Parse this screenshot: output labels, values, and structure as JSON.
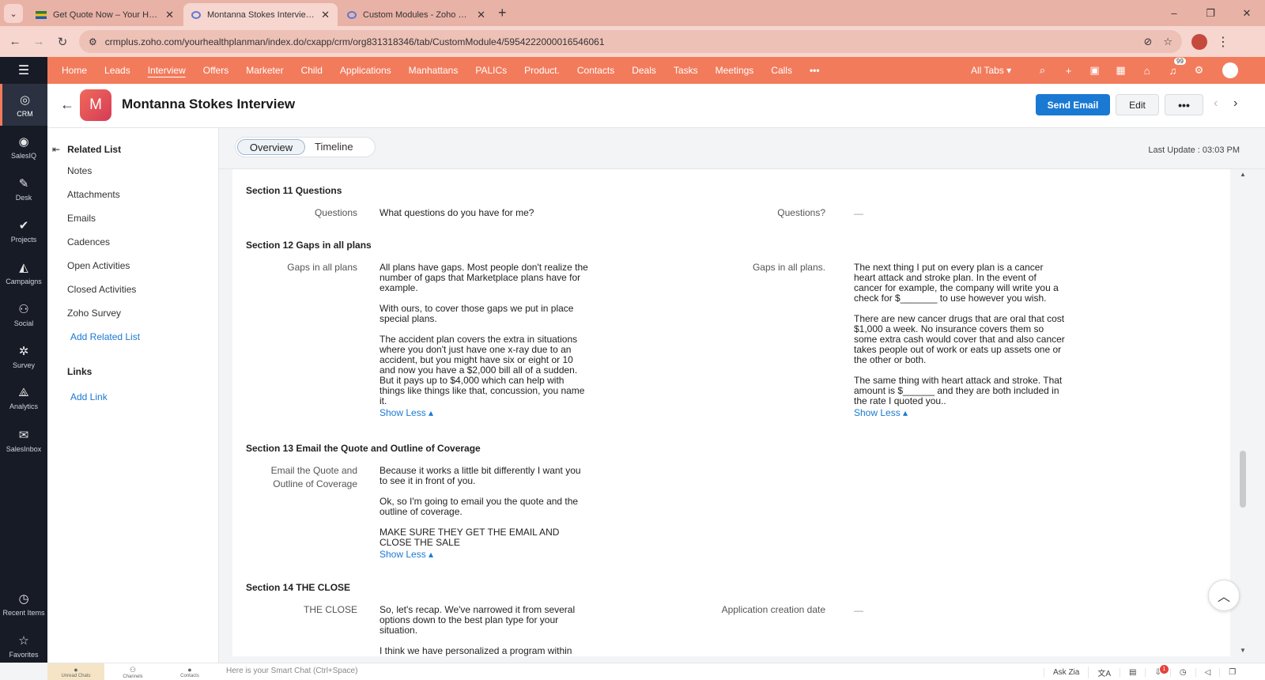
{
  "browser": {
    "tabs": [
      {
        "title": "Get Quote Now – Your Health P",
        "active": false
      },
      {
        "title": "Montanna Stokes Interview (Int",
        "active": true
      },
      {
        "title": "Custom Modules - Zoho CRM",
        "active": false
      }
    ],
    "url": "crmplus.zoho.com/yourhealthplanman/index.do/cxapp/crm/org831318346/tab/CustomModule4/5954222000016546061"
  },
  "topnav": {
    "items": [
      "Home",
      "Leads",
      "Interview",
      "Offers",
      "Marketer",
      "Child",
      "Applications",
      "Manhattans",
      "PALICs",
      "Product.",
      "Contacts",
      "Deals",
      "Tasks",
      "Meetings",
      "Calls"
    ],
    "active": "Interview",
    "more": "•••",
    "all_tabs": "All Tabs ▾",
    "notification_count": "99"
  },
  "leftbar": {
    "items": [
      {
        "label": "CRM",
        "icon": "crm-icon"
      },
      {
        "label": "SalesIQ",
        "icon": "salesiq-icon"
      },
      {
        "label": "Desk",
        "icon": "desk-icon"
      },
      {
        "label": "Projects",
        "icon": "projects-icon"
      },
      {
        "label": "Campaigns",
        "icon": "campaigns-icon"
      },
      {
        "label": "Social",
        "icon": "social-icon"
      },
      {
        "label": "Survey",
        "icon": "survey-icon"
      },
      {
        "label": "Analytics",
        "icon": "analytics-icon"
      },
      {
        "label": "SalesInbox",
        "icon": "salesinbox-icon"
      }
    ],
    "bottom": [
      {
        "label": "Recent Items",
        "icon": "clock-icon"
      },
      {
        "label": "Favorites",
        "icon": "star-icon"
      }
    ]
  },
  "record": {
    "avatar_letter": "M",
    "title": "Montanna Stokes Interview",
    "send_email": "Send Email",
    "edit": "Edit",
    "more": "•••"
  },
  "related": {
    "header": "Related List",
    "items": [
      "Notes",
      "Attachments",
      "Emails",
      "Cadences",
      "Open Activities",
      "Closed Activities",
      "Zoho Survey"
    ],
    "add_related": "Add Related List",
    "links_header": "Links",
    "add_link": "Add Link"
  },
  "view_tabs": {
    "overview": "Overview",
    "timeline": "Timeline"
  },
  "last_update": "Last Update : 03:03 PM",
  "sections": {
    "s11": {
      "title": "Section 11 Questions",
      "left_label": "Questions",
      "left_value": "What questions do you have for me?",
      "right_label": "Questions?",
      "right_value": "—"
    },
    "s12": {
      "title": "Section 12 Gaps in all plans",
      "left_label": "Gaps in all plans",
      "left_paragraphs": [
        "All plans have gaps. Most people don't realize the number of gaps that Marketplace plans have for example.",
        "With ours, to cover those gaps we put in place special plans.",
        "The accident plan covers the extra in situations where you don't just have one x-ray due to an accident, but you might have six or eight or 10 and now you have a $2,000 bill all of a sudden. But it pays up to $4,000 which can help with things like things like that, concussion, you name it."
      ],
      "right_label": "Gaps in all plans.",
      "right_paragraphs": [
        "The next thing I put on every plan is a cancer heart attack and stroke plan. In the event of cancer for example, the company will write you a check for $_______ to use however you wish.",
        "There are new cancer drugs that are oral that cost $1,000 a week. No insurance covers them so some extra cash would cover that and also cancer takes people out of work or eats up assets one or the other or both.",
        "The same thing with heart attack and stroke. That amount is $______ and they are both included in the rate I quoted you.."
      ]
    },
    "s13": {
      "title": "Section 13 Email the Quote and Outline of Coverage",
      "left_label": "Email the Quote and Outline of Coverage",
      "left_paragraphs": [
        "Because it works a little bit differently I want you to see it in front of you.",
        "Ok, so I'm going to email you the quote and the outline of coverage.",
        "MAKE SURE THEY GET THE EMAIL AND CLOSE THE SALE"
      ]
    },
    "s14": {
      "title": "Section 14 THE CLOSE",
      "left_label": "THE CLOSE",
      "left_paragraphs": [
        "So, let's recap. We've narrowed it from several options down to the best plan type for your situation.",
        "I think we have personalized a program within"
      ],
      "right_label": "Application creation date",
      "right_value": "—"
    },
    "show_less": "Show Less ▴"
  },
  "bottombar": {
    "unread": "Unread Chats",
    "channels": "Channels",
    "contacts": "Contacts",
    "smart_chat": "Here is your Smart Chat (Ctrl+Space)",
    "ask_zia": "Ask Zia",
    "badge": "1"
  }
}
